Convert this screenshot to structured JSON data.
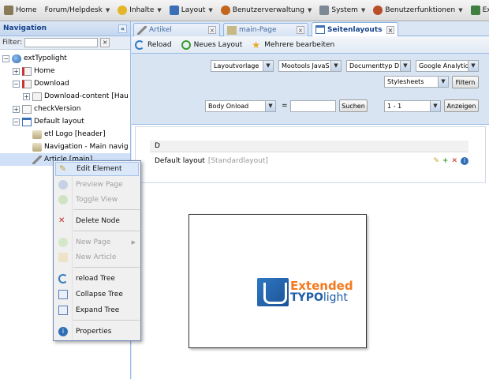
{
  "topbar": {
    "items": [
      {
        "label": "Home",
        "icon": "home-icon",
        "has_menu": false,
        "color": "#7a6a4a"
      },
      {
        "label": "Forum/Helpdesk",
        "icon": "",
        "has_menu": true
      },
      {
        "label": "Inhalte",
        "icon": "content-icon",
        "has_menu": true,
        "color": "#d4a017"
      },
      {
        "label": "Layout",
        "icon": "layout-icon",
        "has_menu": true,
        "color": "#3a6fb8"
      },
      {
        "label": "Benutzerverwaltung",
        "icon": "users-icon",
        "has_menu": true,
        "color": "#c2661d"
      },
      {
        "label": "System",
        "icon": "tools-icon",
        "has_menu": true,
        "color": "#6c7a89"
      },
      {
        "label": "Benutzerfunktionen",
        "icon": "user-functions-icon",
        "has_menu": true,
        "color": "#b84f2a"
      },
      {
        "label": "ExtJs Options",
        "icon": "extjs-icon",
        "has_menu": false,
        "color": "#2f6e2f"
      }
    ]
  },
  "nav": {
    "title": "Navigation",
    "collapse_symbol": "«",
    "filter_label": "Filter:",
    "filter_value": "",
    "filter_clear": "×",
    "tree": [
      {
        "label": "extTypolight",
        "level": 0,
        "expander": "−",
        "icon": "globe-icon"
      },
      {
        "label": "Home",
        "level": 1,
        "expander": "+",
        "icon": "page-icon"
      },
      {
        "label": "Download",
        "level": 1,
        "expander": "−",
        "icon": "page-icon"
      },
      {
        "label": "Download-content [Hau",
        "level": 2,
        "expander": "+",
        "icon": "page-icon"
      },
      {
        "label": "checkVersion",
        "level": 1,
        "expander": "+",
        "icon": "doc-icon"
      },
      {
        "label": "Default layout",
        "level": 1,
        "expander": "−",
        "icon": "layout-icon"
      },
      {
        "label": "etl Logo [header]",
        "level": 2,
        "expander": "",
        "icon": "module-icon"
      },
      {
        "label": "Navigation - Main navig",
        "level": 2,
        "expander": "",
        "icon": "module-icon"
      },
      {
        "label": "Article [main]",
        "level": 2,
        "expander": "",
        "icon": "edit-icon",
        "selected": true
      }
    ]
  },
  "tabs": [
    {
      "label": "Artikel",
      "active": false
    },
    {
      "label": "main-Page",
      "active": false
    },
    {
      "label": "Seitenlayouts",
      "active": true
    }
  ],
  "tab_close": "×",
  "toolbar": {
    "reload": "Reload",
    "new_layout": "Neues Layout",
    "edit_favorites": "Mehrere bearbeiten"
  },
  "filters": {
    "layoutvorlage": "Layoutvorlage",
    "mootools": "Mootools JavaS",
    "doctype": "Documenttyp D",
    "analytics": "Google Analytic",
    "stylesheets": "Stylesheets",
    "filter_button": "Filtern",
    "onload_select": "Body Onload",
    "equals": "=",
    "search_value": "",
    "search_button": "Suchen",
    "range_select": "1 - 1",
    "show_button": "Anzeigen"
  },
  "grid": {
    "header": "D",
    "row_label": "Default layout",
    "row_sub": "[Standardlayout]",
    "row_actions": [
      "edit-icon",
      "add-icon",
      "delete-icon",
      "info-icon"
    ]
  },
  "logo": {
    "line1": "Extended",
    "line2_bold": "TYPO",
    "line2_light": "light"
  },
  "context_menu": {
    "items": [
      {
        "label": "Edit Element",
        "icon": "edit-icon",
        "disabled": false,
        "hover": true
      },
      {
        "label": "Preview Page",
        "icon": "preview-icon",
        "disabled": true
      },
      {
        "label": "Toggle View",
        "icon": "toggle-view-icon",
        "disabled": true
      },
      {
        "label": "Delete Node",
        "icon": "delete-icon",
        "disabled": false
      },
      {
        "label": "New Page",
        "icon": "new-page-icon",
        "disabled": true,
        "submenu": true
      },
      {
        "label": "New Article",
        "icon": "new-article-icon",
        "disabled": true
      },
      {
        "label": "reload Tree",
        "icon": "reload-icon",
        "disabled": false
      },
      {
        "label": "Collapse Tree",
        "icon": "collapse-icon",
        "disabled": false
      },
      {
        "label": "Expand Tree",
        "icon": "expand-icon",
        "disabled": false
      },
      {
        "label": "Properties",
        "icon": "info-icon",
        "disabled": false
      }
    ]
  }
}
